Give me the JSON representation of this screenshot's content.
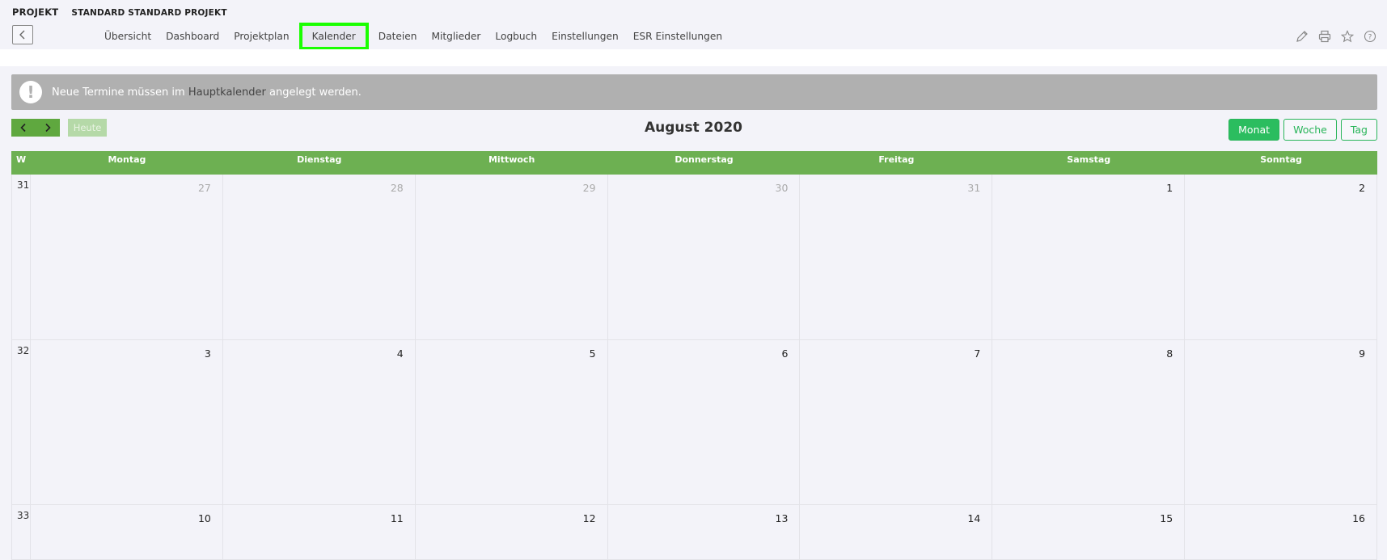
{
  "header": {
    "section": "PROJEKT",
    "project_name": "STANDARD STANDARD PROJEKT"
  },
  "nav": {
    "items": [
      {
        "label": "Übersicht"
      },
      {
        "label": "Dashboard"
      },
      {
        "label": "Projektplan"
      },
      {
        "label": "Kalender",
        "active": true
      },
      {
        "label": "Dateien"
      },
      {
        "label": "Mitglieder"
      },
      {
        "label": "Logbuch"
      },
      {
        "label": "Einstellungen"
      },
      {
        "label": "ESR Einstellungen"
      }
    ]
  },
  "tools": [
    "pencil-icon",
    "printer-icon",
    "star-icon",
    "help-icon"
  ],
  "alert": {
    "icon": "exclamation-icon",
    "text_before": "Neue Termine müssen im",
    "link": "Hauptkalender",
    "text_after": "angelegt werden."
  },
  "calendar": {
    "title": "August 2020",
    "today_label": "Heute",
    "views": [
      "Monat",
      "Woche",
      "Tag"
    ],
    "active_view": "Monat",
    "week_header": "W",
    "weekdays": [
      "Montag",
      "Dienstag",
      "Mittwoch",
      "Donnerstag",
      "Freitag",
      "Samstag",
      "Sonntag"
    ],
    "weeks": [
      {
        "number": "31",
        "days": [
          {
            "d": "27",
            "other": true
          },
          {
            "d": "28",
            "other": true
          },
          {
            "d": "29",
            "other": true
          },
          {
            "d": "30",
            "other": true
          },
          {
            "d": "31",
            "other": true
          },
          {
            "d": "1"
          },
          {
            "d": "2"
          }
        ]
      },
      {
        "number": "32",
        "days": [
          {
            "d": "3"
          },
          {
            "d": "4"
          },
          {
            "d": "5"
          },
          {
            "d": "6"
          },
          {
            "d": "7"
          },
          {
            "d": "8"
          },
          {
            "d": "9"
          }
        ]
      },
      {
        "number": "33",
        "days": [
          {
            "d": "10"
          },
          {
            "d": "11"
          },
          {
            "d": "12"
          },
          {
            "d": "13"
          },
          {
            "d": "14"
          },
          {
            "d": "15"
          },
          {
            "d": "16"
          }
        ]
      }
    ]
  },
  "colors": {
    "accent": "#2bbd5f",
    "header_green": "#6db052",
    "highlight": "#1aff00",
    "alert_bg": "#b0b0b0"
  }
}
